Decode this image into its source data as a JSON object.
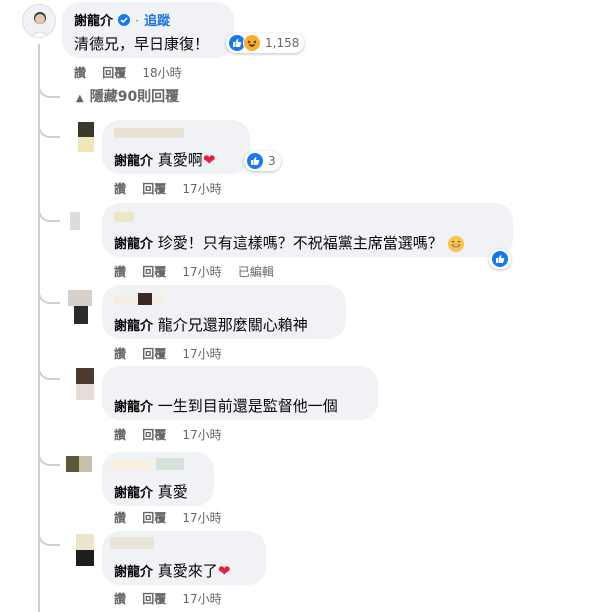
{
  "top_comment": {
    "author": "謝龍介",
    "follow_label": "追蹤",
    "text": "清德兄，早日康復！",
    "reaction_count": "1,158",
    "actions": {
      "like": "讚",
      "reply": "回覆",
      "time": "18小時"
    }
  },
  "hidden_replies_label": "隱藏90則回覆",
  "replies": [
    {
      "mention": "謝龍介",
      "text": "真愛啊",
      "emoji": "heart",
      "reaction_count": "3",
      "actions": {
        "like": "讚",
        "reply": "回覆",
        "time": "17小時"
      }
    },
    {
      "mention": "謝龍介",
      "text": "珍愛！只有這樣嗎？不祝福黨主席當選嗎？",
      "emoji": "grin",
      "reaction_icon": "like",
      "actions": {
        "like": "讚",
        "reply": "回覆",
        "time": "17小時",
        "edited": "已編輯"
      }
    },
    {
      "mention": "謝龍介",
      "text": "龍介兄還那麼關心賴神",
      "actions": {
        "like": "讚",
        "reply": "回覆",
        "time": "17小時"
      }
    },
    {
      "mention": "謝龍介",
      "text": "一生到目前還是監督他一個",
      "actions": {
        "like": "讚",
        "reply": "回覆",
        "time": "17小時"
      }
    },
    {
      "mention": "謝龍介",
      "text": "真愛",
      "actions": {
        "like": "讚",
        "reply": "回覆",
        "time": "17小時"
      }
    },
    {
      "mention": "謝龍介",
      "text": "真愛來了",
      "emoji": "heart",
      "actions": {
        "like": "讚",
        "reply": "回覆",
        "time": "17小時"
      }
    }
  ],
  "colors": {
    "bubble": "#f0f2f5",
    "meta": "#65676b",
    "link": "#1b74e4",
    "like": "#1877f2",
    "heart": "#e41e3f"
  }
}
